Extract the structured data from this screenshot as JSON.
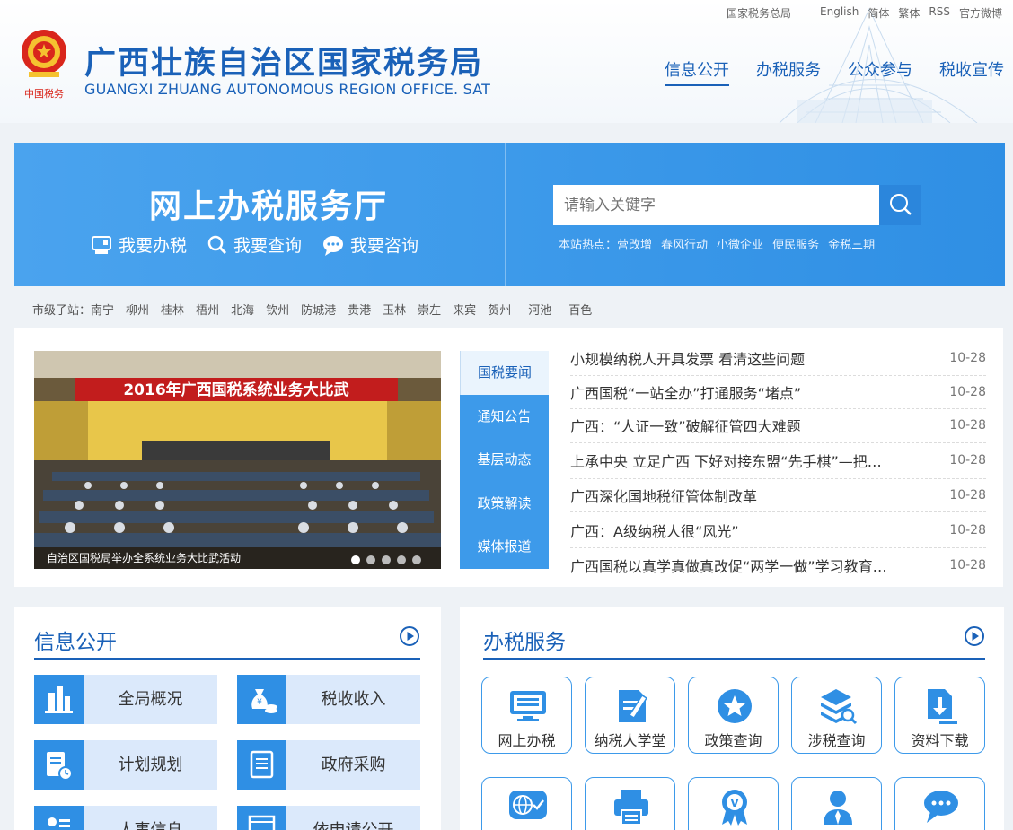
{
  "header": {
    "top_links": [
      "国家税务总局",
      "English",
      "简体",
      "繁体",
      "RSS",
      "官方微博"
    ],
    "title": "广西壮族自治区国家税务局",
    "title_en": "GUANGXI ZHUANG AUTONOMOUS REGION OFFICE. SAT",
    "emblem_text": "中国税务",
    "nav": [
      "信息公开",
      "办税服务",
      "公众参与",
      "税收宣传"
    ]
  },
  "banner": {
    "title": "网上办税服务厅",
    "links": [
      "我要办税",
      "我要查询",
      "我要咨询"
    ],
    "search_placeholder": "请输入关键字",
    "hot_label": "本站热点：",
    "hot_links": [
      "营改增",
      "春风行动",
      "小微企业",
      "便民服务",
      "金税三期"
    ]
  },
  "citybar": {
    "label": "市级子站：",
    "cities": [
      "南宁",
      "柳州",
      "桂林",
      "梧州",
      "北海",
      "钦州",
      "防城港",
      "贵港",
      "玉林",
      "崇左",
      "来宾",
      "贺州",
      "河池",
      "百色"
    ]
  },
  "slideshow": {
    "banner_text": "2016年广西国税系统业务大比武",
    "caption": "自治区国税局举办全系统业务大比武活动",
    "dot_count": 5,
    "active_dot": 1
  },
  "news_tabs": [
    "国税要闻",
    "通知公告",
    "基层动态",
    "政策解读",
    "媒体报道"
  ],
  "news": [
    {
      "title": "小规模纳税人开具发票 看清这些问题",
      "date": "10-28"
    },
    {
      "title": "广西国税“一站全办”打通服务“堵点”",
      "date": "10-28"
    },
    {
      "title": "广西：“人证一致”破解征管四大难题",
      "date": "10-28"
    },
    {
      "title": "上承中央 立足广西 下好对接东盟“先手棋”—把…",
      "date": "10-28"
    },
    {
      "title": "广西深化国地税征管体制改革",
      "date": "10-28"
    },
    {
      "title": "广西：A级纳税人很“风光”",
      "date": "10-28"
    },
    {
      "title": "广西国税以真学真做真改促“两学一做”学习教育…",
      "date": "10-28"
    }
  ],
  "info_public": {
    "title": "信息公开",
    "items": [
      "全局概况",
      "税收收入",
      "计划规划",
      "政府采购",
      "人事信息",
      "依申请公开"
    ]
  },
  "tax_service": {
    "title": "办税服务",
    "items": [
      "网上办税",
      "纳税人学堂",
      "政策查询",
      "涉税查询",
      "资料下载",
      "",
      "",
      "",
      "",
      ""
    ]
  },
  "colors": {
    "brand": "#1a61b8",
    "accent": "#3d9aea"
  }
}
